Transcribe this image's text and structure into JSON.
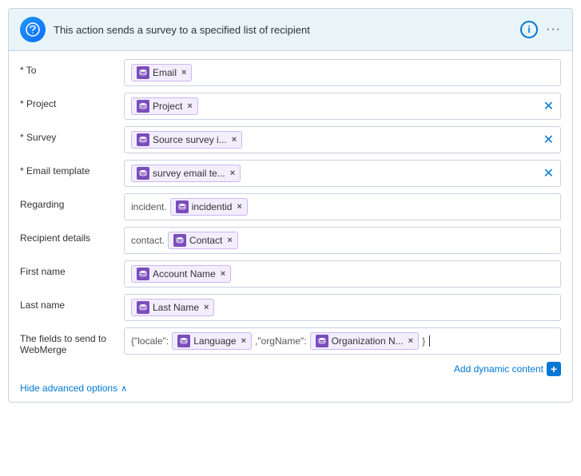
{
  "header": {
    "icon_text": "S",
    "title": "This action sends a survey to a specified list of recipient",
    "info_label": "i",
    "more_label": "···"
  },
  "fields": [
    {
      "id": "to",
      "label": "To",
      "required": true,
      "tokens": [
        {
          "text": "Email",
          "has_x": true
        }
      ],
      "has_field_x": false
    },
    {
      "id": "project",
      "label": "Project",
      "required": true,
      "tokens": [
        {
          "text": "Project",
          "has_x": true
        }
      ],
      "has_field_x": true
    },
    {
      "id": "survey",
      "label": "Survey",
      "required": true,
      "tokens": [
        {
          "text": "Source survey i...",
          "has_x": true
        }
      ],
      "has_field_x": true
    },
    {
      "id": "email-template",
      "label": "Email template",
      "required": true,
      "tokens": [
        {
          "text": "survey email te...",
          "has_x": true
        }
      ],
      "has_field_x": true
    },
    {
      "id": "regarding",
      "label": "Regarding",
      "required": false,
      "prefix": "incident.",
      "tokens": [
        {
          "text": "incidentid",
          "has_x": true
        }
      ],
      "has_field_x": false
    },
    {
      "id": "recipient-details",
      "label": "Recipient details",
      "required": false,
      "prefix": "contact.",
      "tokens": [
        {
          "text": "Contact",
          "has_x": true
        }
      ],
      "has_field_x": false
    },
    {
      "id": "first-name",
      "label": "First name",
      "required": false,
      "tokens": [
        {
          "text": "Account Name",
          "has_x": true
        }
      ],
      "has_field_x": false
    },
    {
      "id": "last-name",
      "label": "Last name",
      "required": false,
      "tokens": [
        {
          "text": "Last Name",
          "has_x": true
        }
      ],
      "has_field_x": false
    }
  ],
  "webmerge": {
    "id": "webmerge",
    "label": "The fields to send to WebMerge",
    "prefix1": "{\"locale\":",
    "token1": "Language",
    "between": ",\"orgName\":",
    "token2": "Organization N...",
    "suffix": "}"
  },
  "add_dynamic_label": "Add dynamic content",
  "add_dynamic_plus": "+",
  "hide_advanced_label": "Hide advanced options",
  "chevron": "∧"
}
